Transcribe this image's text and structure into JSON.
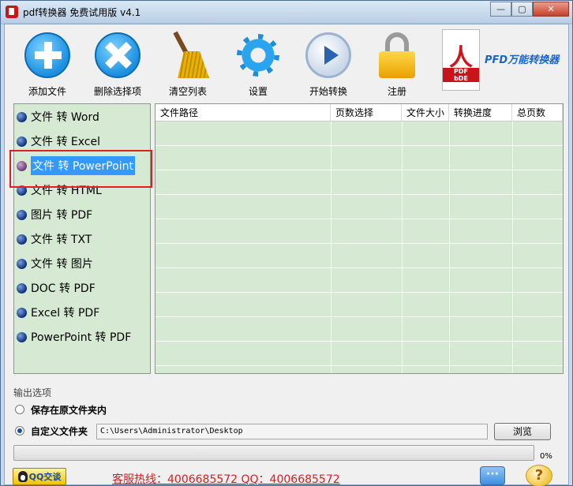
{
  "window": {
    "title": "pdf转换器 免费试用版 v4.1",
    "controls": {
      "minimize": "—",
      "maximize": "▢",
      "close": "✕"
    }
  },
  "toolbar": {
    "add_file": "添加文件",
    "remove_selected": "删除选择项",
    "clear_list": "清空列表",
    "settings": "设置",
    "start_convert": "开始转换",
    "register": "注册",
    "brand_text": "PFD万能转换器",
    "pdf_badge_top": "PDF",
    "pdf_badge_bottom": "bDE"
  },
  "sidebar": {
    "items": [
      {
        "label": "文件 转 Word",
        "selected": false
      },
      {
        "label": "文件 转 Excel",
        "selected": false
      },
      {
        "label": "文件 转 PowerPoint",
        "selected": true
      },
      {
        "label": "文件 转 HTML",
        "selected": false
      },
      {
        "label": "图片 转 PDF",
        "selected": false
      },
      {
        "label": "文件 转 TXT",
        "selected": false
      },
      {
        "label": "文件 转 图片",
        "selected": false
      },
      {
        "label": "DOC 转 PDF",
        "selected": false
      },
      {
        "label": "Excel 转 PDF",
        "selected": false
      },
      {
        "label": "PowerPoint 转 PDF",
        "selected": false
      }
    ]
  },
  "file_table": {
    "columns": [
      "文件路径",
      "页数选择",
      "文件大小",
      "转换进度",
      "总页数"
    ],
    "rows": []
  },
  "output": {
    "title": "输出选项",
    "option_original": "保存在原文件夹内",
    "option_custom": "自定义文件夹",
    "custom_selected": true,
    "path": "C:\\Users\\Administrator\\Desktop",
    "browse_label": "浏览"
  },
  "progress": {
    "value": 0,
    "label": "0%"
  },
  "footer": {
    "qq_label": "QQ交谈",
    "hotline": "客服热线：4006685572 QQ：4006685572",
    "chat_icon_glyph": "···",
    "help_icon_glyph": "?"
  },
  "colors": {
    "panel_bg": "#d6ead3",
    "selection": "#3399ff",
    "highlight_box": "#e02020",
    "hotline": "#d62020",
    "brand": "#1a66c8"
  }
}
